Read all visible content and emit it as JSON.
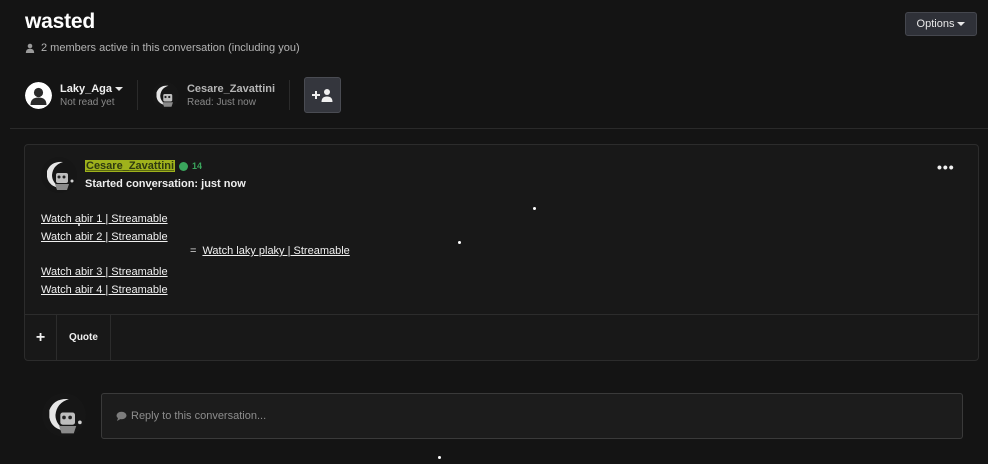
{
  "header": {
    "title": "wasted",
    "members_text": "2 members active in this conversation (including you)",
    "options_label": "Options"
  },
  "participants": [
    {
      "name": "Laky_Aga",
      "status": "Not read yet"
    },
    {
      "name": "Cesare_Zavattini",
      "status": "Read: Just now"
    }
  ],
  "message": {
    "author": "Cesare_Zavattini",
    "reputation": "14",
    "started_text": "Started conversation: just now",
    "more_label": "•••",
    "links_group1": [
      "Watch abir 1 | Streamable",
      "Watch abir 2 | Streamable"
    ],
    "links_group2": [
      "Watch abir 3 | Streamable",
      "Watch abir 4 | Streamable"
    ],
    "equals_sign": "=",
    "equals_link": "Watch laky plaky | Streamable",
    "footer": {
      "plus_label": "+",
      "quote_label": "Quote"
    }
  },
  "reply": {
    "placeholder": "Reply to this conversation..."
  },
  "colors": {
    "background": "#141414",
    "author_highlight": "#9fb21c",
    "reputation": "#3aa55c"
  }
}
